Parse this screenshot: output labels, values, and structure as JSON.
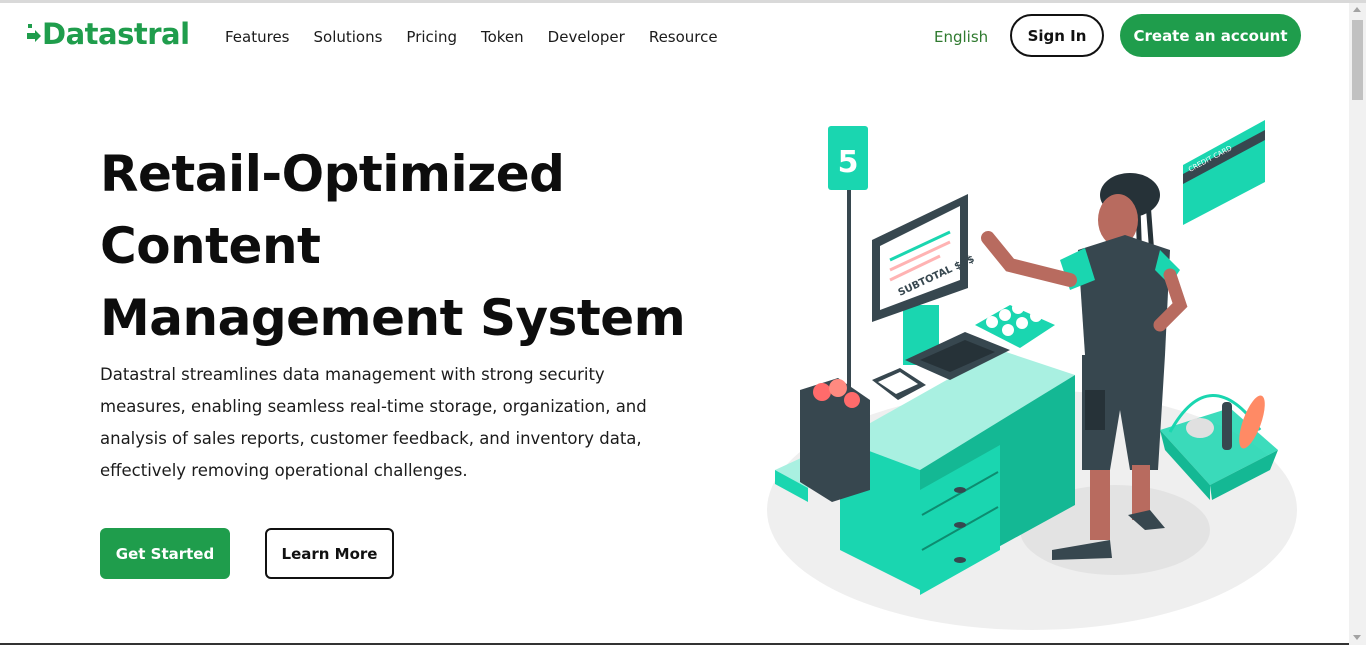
{
  "brand": {
    "name": "Datastral",
    "color": "#1f9d4c"
  },
  "nav": {
    "items": [
      "Features",
      "Solutions",
      "Pricing",
      "Token",
      "Developer",
      "Resource"
    ],
    "language": "English",
    "sign_in": "Sign In",
    "create_account": "Create an account"
  },
  "hero": {
    "title_lines": [
      "Retail-Optimized",
      "Content",
      "Management System"
    ],
    "description": "Datastral streamlines data management with strong security measures, enabling seamless real-time storage, organization, and analysis of sales reports, customer feedback, and inventory data, effectively removing operational challenges.",
    "primary_cta": "Get Started",
    "secondary_cta": "Learn More"
  },
  "illustration": {
    "lane_number": "5",
    "screen_text": "SUBTOTAL $$$",
    "card_text": "CREDIT CARD",
    "accent": "#1ad6b0"
  }
}
